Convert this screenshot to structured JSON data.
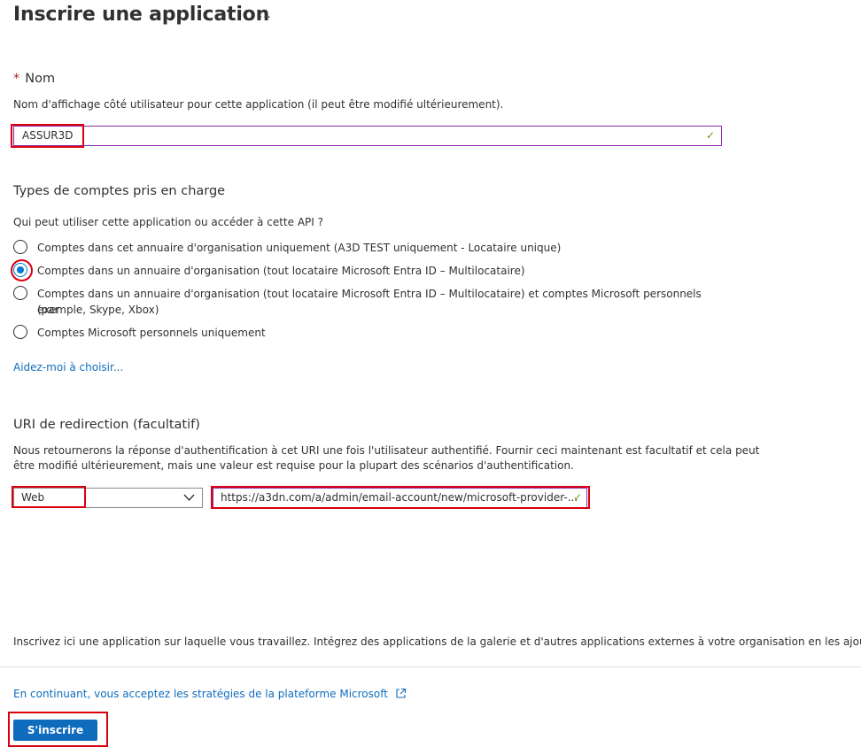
{
  "page": {
    "title": "Inscrire une application",
    "more_icon": "…"
  },
  "name_section": {
    "required_marker": "*",
    "label": "Nom",
    "description": "Nom d'affichage côté utilisateur pour cette application (il peut être modifié ultérieurement).",
    "input_value": "ASSUR3D",
    "valid_icon": "✓"
  },
  "accounts_section": {
    "title": "Types de comptes pris en charge",
    "question": "Qui peut utiliser cette application ou accéder à cette API ?",
    "options": [
      {
        "label": "Comptes dans cet annuaire d'organisation uniquement (A3D TEST uniquement - Locataire unique)",
        "selected": false
      },
      {
        "label": "Comptes dans un annuaire d'organisation (tout locataire Microsoft Entra ID – Multilocataire)",
        "selected": true
      },
      {
        "label": "Comptes dans un annuaire d'organisation (tout locataire Microsoft Entra ID – Multilocataire) et comptes Microsoft personnels (par",
        "label_line2": "exemple, Skype, Xbox)",
        "selected": false
      },
      {
        "label": "Comptes Microsoft personnels uniquement",
        "selected": false
      }
    ],
    "help_link": "Aidez-moi à choisir..."
  },
  "redirect_section": {
    "title": "URI de redirection (facultatif)",
    "description_line1": "Nous retournerons la réponse d'authentification à cet URI une fois l'utilisateur authentifié. Fournir ceci maintenant est facultatif et cela peut",
    "description_line2": "être modifié ultérieurement, mais une valeur est requise pour la plupart des scénarios d'authentification.",
    "platform_value": "Web",
    "uri_value": "https://a3dn.com/a/admin/email-account/new/microsoft-provider-...",
    "valid_icon": "✓"
  },
  "footer": {
    "info_text": "Inscrivez ici une application sur laquelle vous travaillez. Intégrez des applications de la galerie et d'autres applications externes à votre organisation en les ajoutant à par",
    "policy_link": "En continuant, vous acceptez les stratégies de la plateforme Microsoft",
    "register_button": "S'inscrire"
  },
  "colors": {
    "accent": "#0f6cbd",
    "highlight": "#d9000f",
    "valid": "#57a300",
    "input_border_active": "#8a2da5"
  }
}
